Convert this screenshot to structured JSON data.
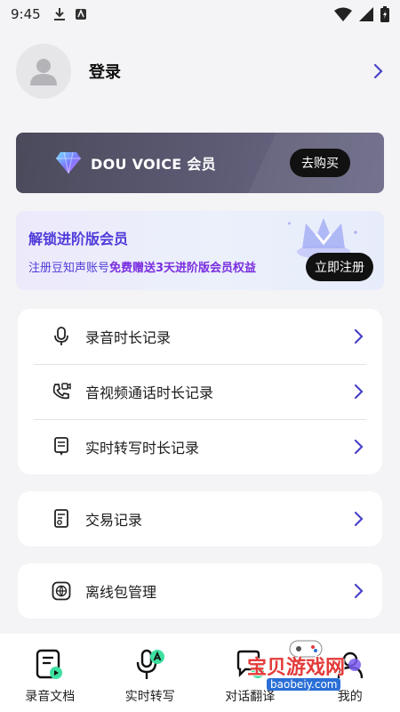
{
  "status_bar": {
    "time": "9:45"
  },
  "profile": {
    "login_label": "登录"
  },
  "vip": {
    "title": "DOU VOICE 会员",
    "buy_label": "去购买"
  },
  "promo": {
    "title": "解锁进阶版会员",
    "subtitle_prefix": "注册豆知声账号",
    "subtitle_highlight": "免费赠送3天进阶版会员权益",
    "register_label": "立即注册"
  },
  "records": [
    {
      "label": "录音时长记录",
      "icon": "microphone-icon"
    },
    {
      "label": "音视频通话时长记录",
      "icon": "video-call-icon"
    },
    {
      "label": "实时转写时长记录",
      "icon": "transcribe-icon"
    }
  ],
  "trade": {
    "label": "交易记录",
    "icon": "receipt-icon"
  },
  "offline": {
    "label": "离线包管理",
    "icon": "globe-icon"
  },
  "tabs": [
    {
      "label": "录音文档",
      "icon": "recording-doc-icon"
    },
    {
      "label": "实时转写",
      "icon": "realtime-transcribe-icon"
    },
    {
      "label": "对话翻译",
      "icon": "dialog-translate-icon"
    },
    {
      "label": "我的",
      "icon": "profile-icon"
    }
  ],
  "watermark": {
    "text": "宝贝游戏网",
    "url": "baobeiy.com"
  },
  "colors": {
    "accent": "#4f3bd9",
    "chevron": "#4b44c8"
  }
}
